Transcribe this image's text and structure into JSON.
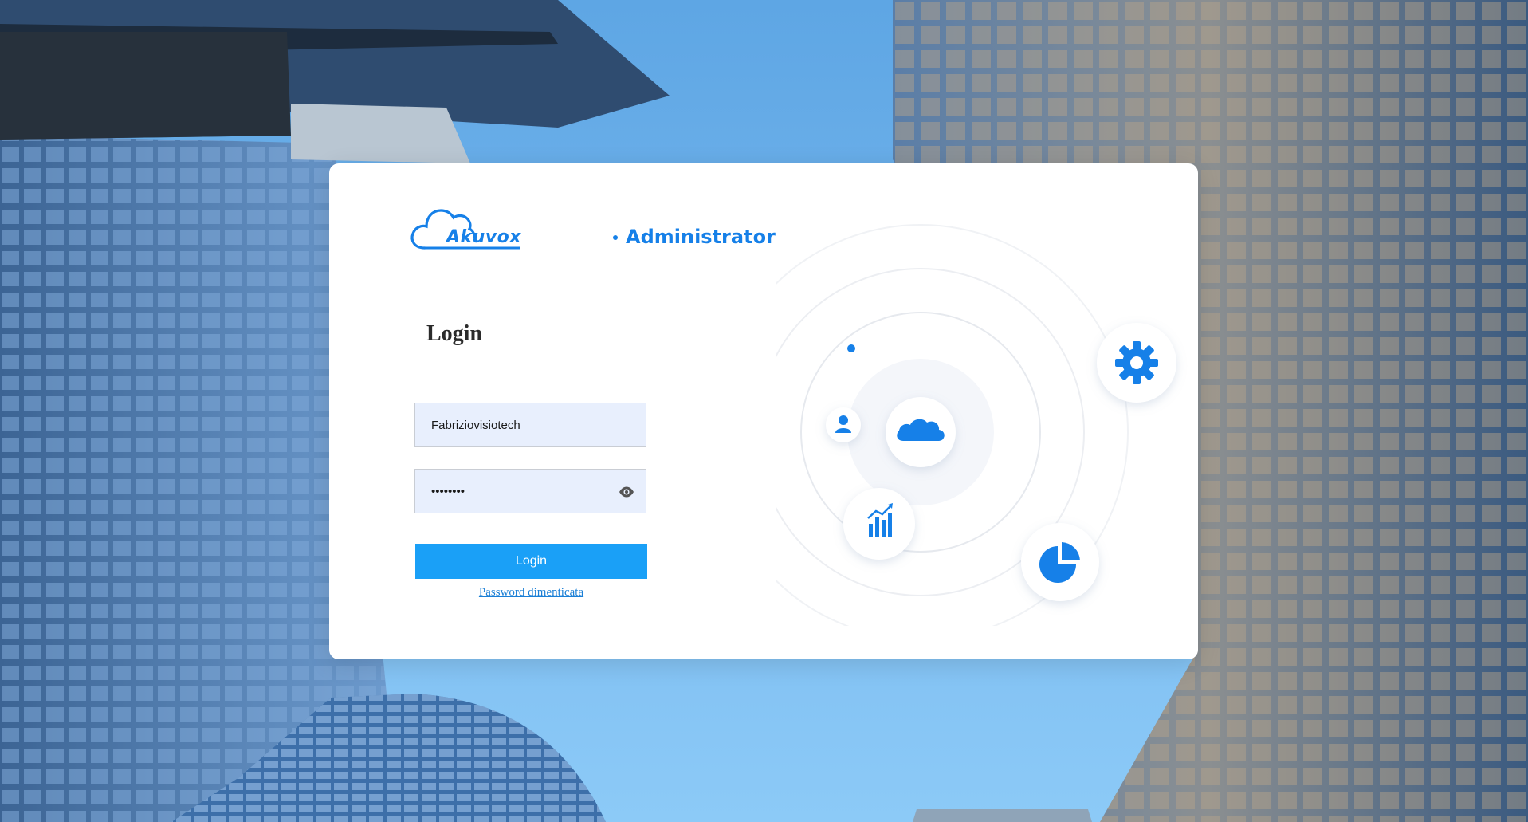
{
  "brand": {
    "name": "Akuvox",
    "separator": "•",
    "product": "Administrator",
    "color": "#1680e8"
  },
  "login_form": {
    "title": "Login",
    "username_value": "Fabriziovisiotech",
    "password_value": "Fabrizio",
    "submit_label": "Login",
    "forgot_link": "Password dimenticata"
  },
  "colors": {
    "accent": "#1aa0f7",
    "icon_blue": "#1680e8",
    "input_bg": "#e8effd"
  },
  "illustration": {
    "center_icon": "cloud-icon",
    "satellite_icons": [
      "gear-icon",
      "user-icon",
      "bar-chart-icon",
      "pie-chart-icon"
    ]
  }
}
